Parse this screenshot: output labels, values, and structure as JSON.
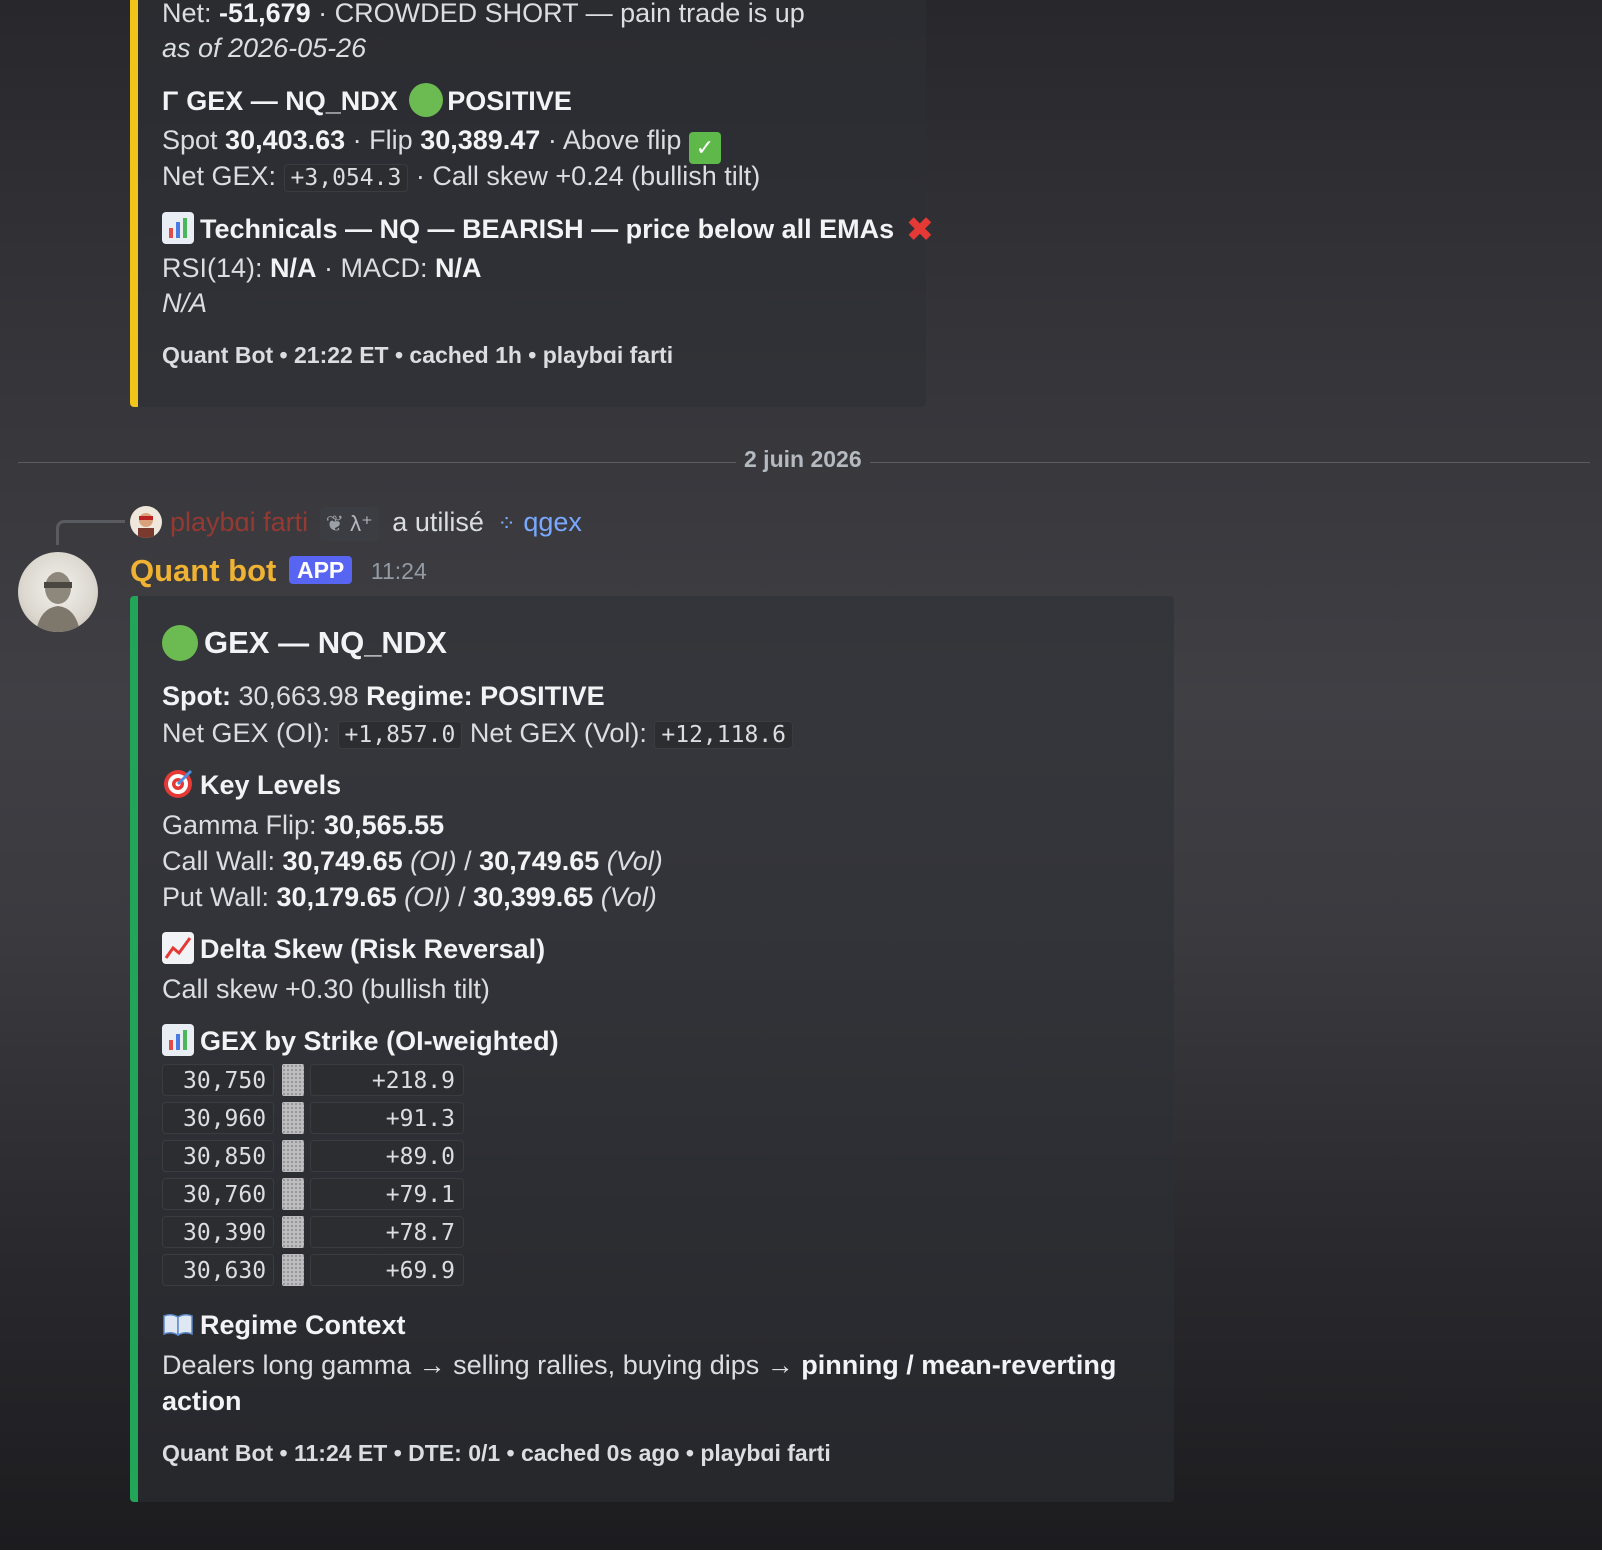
{
  "prev_embed": {
    "net_label": "Net:",
    "net_value": "-51,679",
    "net_rest": " · CROWDED SHORT — pain trade is up",
    "as_of": "as of 2026-05-26",
    "gex_icon": "Γ",
    "gex_title": "GEX — NQ_NDX",
    "gex_regime": "POSITIVE",
    "spot_label": "Spot ",
    "spot_value": "30,403.63",
    "flip_label": " · Flip ",
    "flip_value": "30,389.47",
    "above_flip": " · Above flip",
    "netgex_label": "Net GEX: ",
    "netgex_value": "+3,054.3",
    "call_skew": " · Call skew +0.24 (bullish tilt)",
    "tech_title": "Technicals — NQ — BEARISH — price below all EMAs",
    "rsi_label": "RSI(14): ",
    "rsi_value": "N/A",
    "macd_label": " · MACD: ",
    "macd_value": "N/A",
    "na_line": "N/A",
    "footer": "Quant Bot • 21:22 ET • cached 1h • playbɑi farti",
    "accent_color": "#f0c419"
  },
  "divider": {
    "date": "2 juin 2026"
  },
  "reply": {
    "username": "playbɑi farti",
    "tag": "λ⁺",
    "used_text": "a utilisé",
    "command": "qgex"
  },
  "message": {
    "author": "Quant bot",
    "badge": "APP",
    "time": "11:24"
  },
  "embed": {
    "accent_color": "#23a559",
    "title": "GEX — NQ_NDX",
    "spot_label": "Spot:",
    "spot_value": " 30,663.98 ",
    "regime_label": "Regime: POSITIVE",
    "netgex_oi_label": "Net GEX (OI): ",
    "netgex_oi_value": "+1,857.0",
    "netgex_vol_label": " Net GEX (Vol): ",
    "netgex_vol_value": "+12,118.6",
    "key_levels_title": "Key Levels",
    "gamma_flip_label": "Gamma Flip: ",
    "gamma_flip_value": "30,565.55",
    "call_wall_label": "Call Wall: ",
    "call_wall_oi": "30,749.65",
    "call_wall_vol": "30,749.65",
    "put_wall_label": "Put Wall: ",
    "put_wall_oi": "30,179.65",
    "put_wall_vol": "30,399.65",
    "oi_tag": " (OI)",
    "vol_tag": " (Vol)",
    "slash": " / ",
    "skew_title": "Delta Skew (Risk Reversal)",
    "skew_text": "Call skew +0.30 (bullish tilt)",
    "strike_title": "GEX by Strike (OI-weighted)",
    "strikes": [
      {
        "strike": "30,750",
        "value": "+218.9"
      },
      {
        "strike": "30,960",
        "value": "+91.3"
      },
      {
        "strike": "30,850",
        "value": "+89.0"
      },
      {
        "strike": "30,760",
        "value": "+79.1"
      },
      {
        "strike": "30,390",
        "value": "+78.7"
      },
      {
        "strike": "30,630",
        "value": "+69.9"
      }
    ],
    "regime_title": "Regime Context",
    "regime_text1": "Dealers long gamma → selling rallies, buying dips → ",
    "regime_bold1": "pinning / mean-reverting",
    "regime_bold2": "action",
    "footer": "Quant Bot • 11:24 ET • DTE: 0/1 • cached 0s ago • playbɑi farti"
  },
  "colors": {
    "author": "#f0b232",
    "badge_bg": "#5865f2",
    "username": "#c0392b",
    "command": "#7aa8ff"
  }
}
